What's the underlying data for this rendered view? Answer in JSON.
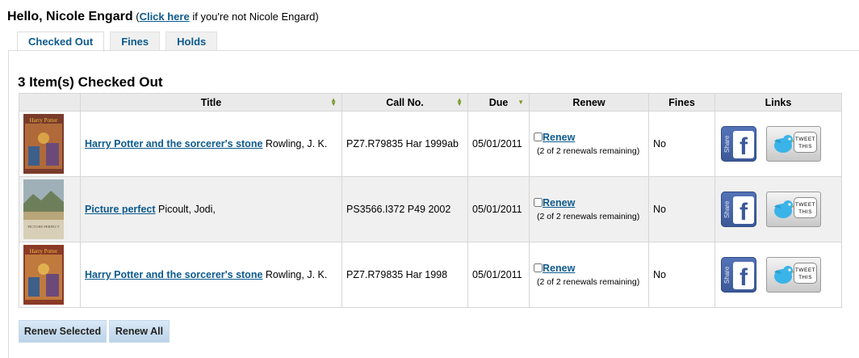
{
  "greeting": {
    "hello": "Hello, Nicole Engard",
    "paren_open": "(",
    "click_here": "Click here",
    "rest": " if you're not Nicole Engard)"
  },
  "tabs": [
    "Checked Out",
    "Fines",
    "Holds"
  ],
  "section_title": "3 Item(s) Checked Out",
  "columns": [
    "Title",
    "Call No.",
    "Due",
    "Renew",
    "Fines",
    "Links"
  ],
  "items": [
    {
      "title": "Harry Potter and the sorcerer's stone",
      "author": "Rowling, J. K.",
      "call_no": "PZ7.R79835 Har 1999ab",
      "due": "05/01/2011",
      "renew_label": "Renew",
      "renew_remaining": "(2 of 2 renewals remaining)",
      "fines": "No",
      "cover_text": "Harry Potter"
    },
    {
      "title": "Picture perfect",
      "author": "Picoult, Jodi,",
      "call_no": "PS3566.I372 P49 2002",
      "due": "05/01/2011",
      "renew_label": "Renew",
      "renew_remaining": "(2 of 2 renewals remaining)",
      "fines": "No",
      "cover_text": "PICTURE PERFECT"
    },
    {
      "title": "Harry Potter and the sorcerer's stone",
      "author": "Rowling, J. K.",
      "call_no": "PZ7.R79835 Har 1998",
      "due": "05/01/2011",
      "renew_label": "Renew",
      "renew_remaining": "(2 of 2 renewals remaining)",
      "fines": "No",
      "cover_text": "Harry Potter"
    }
  ],
  "share_links": {
    "facebook_label": "Share",
    "facebook_letter": "f",
    "tweet_line1": "TWEET",
    "tweet_line2": "THIS"
  },
  "buttons": {
    "renew_selected": "Renew Selected",
    "renew_all": "Renew All"
  },
  "colors": {
    "link": "#0c5a8e",
    "facebook": "#3b5998",
    "twitter": "#33ccff",
    "button": "#c9ddef"
  }
}
